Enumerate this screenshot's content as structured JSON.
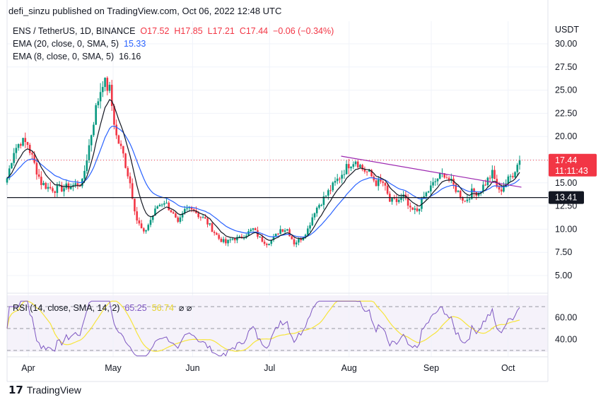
{
  "header": {
    "published": "defi_sinzu published on TradingView.com, Oct 06, 2022 12:48 UTC"
  },
  "legend": {
    "symbol": "ENS / TetherUS, 1D, BINANCE",
    "open": "O17.52",
    "high": "H17.85",
    "low": "L17.21",
    "close": "C17.44",
    "change": "−0.06 (−0.34%)",
    "ema20_label": "EMA (20, close, 0, SMA, 5)",
    "ema20_value": "15.33",
    "ema8_label": "EMA (8, close, 0, SMA, 5)",
    "ema8_value": "16.16",
    "rsi_label": "RSI (14, close, SMA, 14, 2)",
    "rsi_value": "65.25",
    "rsi_sma_value": "56.74",
    "rsi_extra": "⌀ ⌀"
  },
  "footer": {
    "brand": "TradingView"
  },
  "colors": {
    "up": "#089981",
    "down": "#f23645",
    "ema20": "#2962ff",
    "ema8": "#131722",
    "rsi": "#7e57c2",
    "rsi_sma": "#f7e53b",
    "trend": "#9c27b0"
  },
  "chart_data": {
    "type": "candlestick",
    "price_axis": {
      "unit": "USDT",
      "ticks": [
        "30.00",
        "27.50",
        "25.00",
        "22.50",
        "20.00",
        "15.00",
        "12.50",
        "10.00",
        "7.50",
        "5.00"
      ],
      "range": [
        2.5,
        30
      ]
    },
    "time_axis": {
      "ticks": [
        "Apr",
        "May",
        "Jun",
        "Jul",
        "Aug",
        "Sep",
        "Oct"
      ],
      "tick_days": [
        8,
        40,
        70,
        99,
        129,
        160,
        189
      ]
    },
    "closes_every_2_7_days": [
      15.5,
      18.5,
      19.5,
      19.2,
      17,
      15,
      14.5,
      14.3,
      14.4,
      14.6,
      14.8,
      15,
      19,
      23,
      26,
      25,
      20,
      18,
      15,
      11,
      9.5,
      11,
      12.5,
      13,
      12,
      10.5,
      12,
      12.5,
      11.5,
      11,
      10,
      9,
      8.5,
      9,
      9,
      9.5,
      10,
      9,
      8.5,
      9,
      10,
      10,
      8.5,
      9,
      10,
      12,
      13,
      14,
      15,
      16,
      17,
      17.5,
      16.5,
      16,
      15,
      15,
      13,
      13,
      13.5,
      12,
      12,
      13.5,
      14.5,
      15.5,
      16,
      15,
      14,
      13,
      14,
      14,
      15,
      16,
      14,
      15,
      16,
      17.44
    ],
    "last_price": {
      "value": "17.44",
      "countdown": "11:11:43"
    },
    "horizontal_line": {
      "value": "13.41"
    },
    "trendline": {
      "from": {
        "day": 126,
        "price": 17.88
      },
      "to": {
        "day": 194,
        "price": 14.53
      }
    },
    "rsi": {
      "ticks": [
        "60.00",
        "40.00"
      ],
      "levels": [
        70,
        50,
        30
      ],
      "range": [
        25,
        75
      ]
    }
  }
}
